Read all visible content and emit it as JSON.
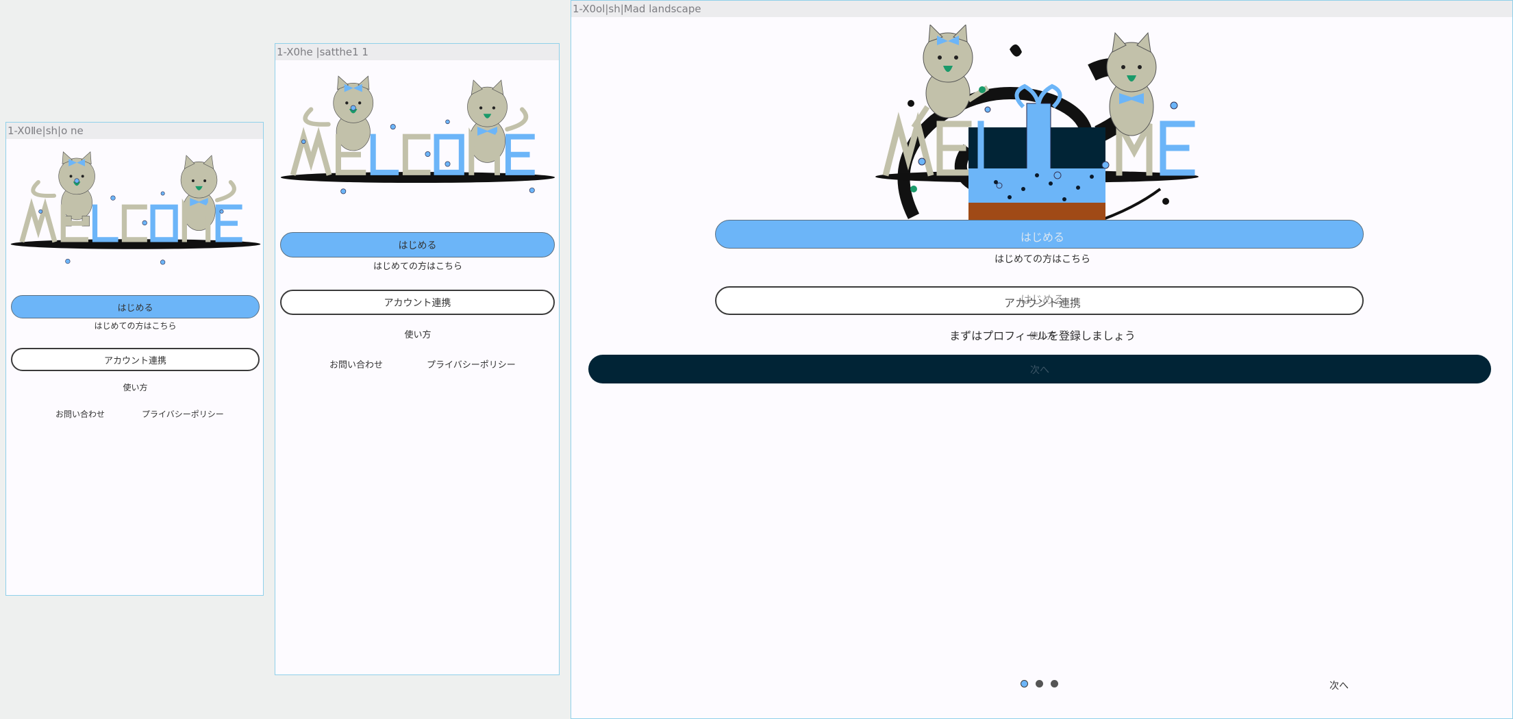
{
  "colors": {
    "primary": "#6cb5f8",
    "cat_body": "#c2c1aa",
    "dark_panel": "#012436",
    "cake_base": "#a04a16",
    "frame_border": "#8fd0ea"
  },
  "hero": {
    "welcome_text": "WELCOME"
  },
  "frames": {
    "iphone": {
      "title": "1-X0Ⅱe|sh|o ne",
      "start_button": "はじめる",
      "first_time_text": "はじめての方はこちら",
      "account_link_button": "アカウント連携",
      "how_to_use_link": "使い方",
      "contact_link": "お問い合わせ",
      "privacy_policy_link": "プライバシーポリシー"
    },
    "iphone11": {
      "title": "1-X0he |satthe1 1",
      "start_button": "はじめる",
      "first_time_text": "はじめての方はこちら",
      "account_link_button": "アカウント連携",
      "how_to_use_link": "使い方",
      "contact_link": "お問い合わせ",
      "privacy_policy_link": "プライバシーポリシー"
    },
    "ipad": {
      "title": "1-X0ol|sh|Mad landscape",
      "start_button": "はじめる",
      "first_time_text": "はじめての方はこちら",
      "account_button_overlap": "アカウント連携",
      "cake_start_label": "はじめる",
      "profile_prompt": "まずはプロフィールを登録しましょう",
      "how_to_use_link": "使い方",
      "panel_next": "次へ",
      "next_link": "次へ",
      "pagination": [
        "active",
        "inactive",
        "inactive"
      ]
    }
  }
}
